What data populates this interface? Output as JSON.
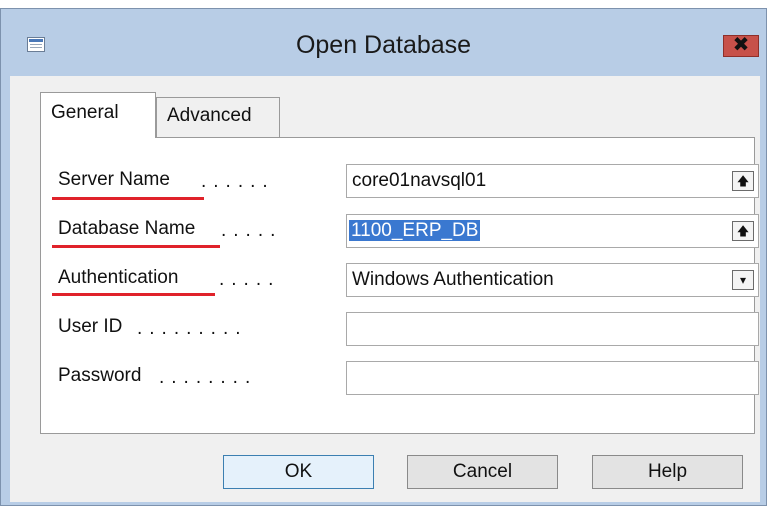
{
  "window": {
    "title": "Open Database",
    "close_glyph": "✖",
    "icon": "database-window-icon"
  },
  "tabs": [
    {
      "label": "General",
      "active": true
    },
    {
      "label": "Advanced",
      "active": false
    }
  ],
  "form": {
    "server_name": {
      "label": "Server Name",
      "value": "core01navsql01",
      "button_glyph": "🡅"
    },
    "database_name": {
      "label": "Database Name",
      "value": "1100_ERP_DB",
      "button_glyph": "🡅"
    },
    "authentication": {
      "label": "Authentication",
      "value": "Windows Authentication",
      "button_glyph": "▾"
    },
    "user_id": {
      "label": "User ID",
      "value": ""
    },
    "password": {
      "label": "Password",
      "value": ""
    }
  },
  "buttons": {
    "ok": "OK",
    "cancel": "Cancel",
    "help": "Help"
  },
  "colors": {
    "titlebar": "#b8cde6",
    "close_button": "#c7514a",
    "annotation_underline": "#e0222a",
    "selection": "#3a78d0"
  }
}
